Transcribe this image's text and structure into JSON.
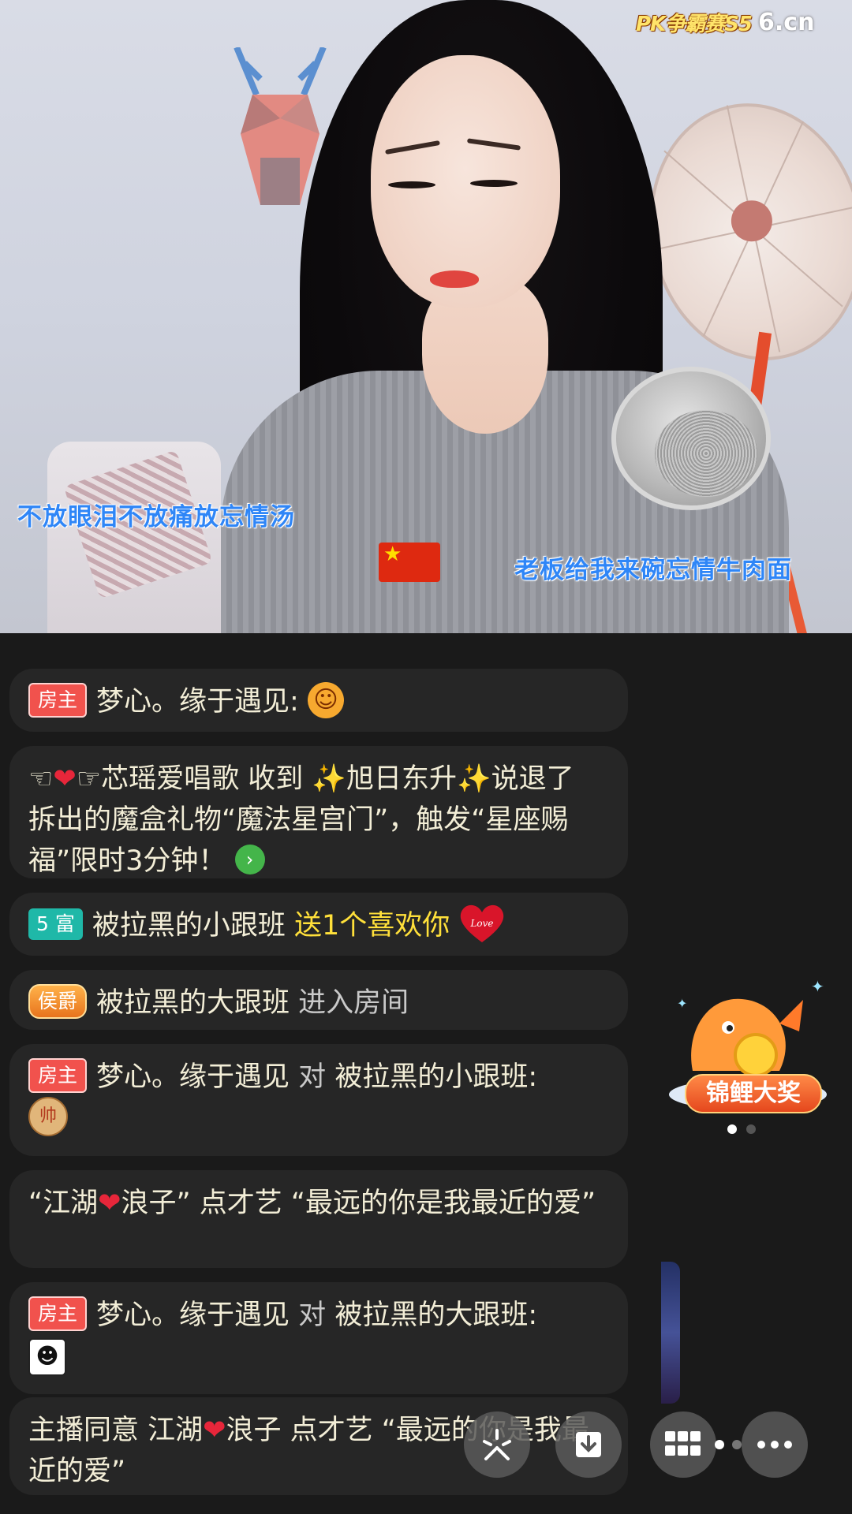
{
  "video": {
    "logo_badge": "PK争霸赛S5",
    "logo_site": "6.cn",
    "lyric_left": "不放眼泪不放痛放忘情汤",
    "lyric_right": "老板给我来碗忘情牛肉面"
  },
  "chat": [
    {
      "badge": "房主",
      "user": "梦心。缘于遇见:",
      "emoji": "face-emoji"
    },
    {
      "text_parts": [
        "芯瑶爱唱歌 收到 ",
        "旭日东升",
        "说退了 拆出的魔盒礼物“魔法星宫门”，触发“星座赐福”限时3分钟！"
      ]
    },
    {
      "badge": "5 富",
      "user": "被拉黑的小跟班",
      "gift": "送1个喜欢你",
      "emoji_text": "Love"
    },
    {
      "badge": "侯爵",
      "user": "被拉黑的大跟班",
      "action": "进入房间"
    },
    {
      "badge": "房主",
      "user": "梦心。缘于遇见",
      "connector": "对",
      "target": "被拉黑的小跟班:",
      "emoji_text": "帅"
    },
    {
      "text_a": "“江湖",
      "text_b": "浪子” 点才艺 “最远的你是我最近的爱”"
    },
    {
      "badge": "房主",
      "user": "梦心。缘于遇见",
      "connector": "对",
      "target": "被拉黑的大跟班:"
    },
    {
      "text_a": "主播同意 江湖",
      "text_b": "浪子 点才艺 “最远的你是我最近的爱”"
    }
  ],
  "prize": {
    "label": "锦鲤大奖"
  },
  "toolbar": {
    "icons": [
      "sparkle-icon",
      "download-icon",
      "grid-icon",
      "more-icon"
    ]
  },
  "colors": {
    "host_badge": "#f1524d",
    "rich_badge": "#1fb8a8",
    "gift_text": "#ffe03a",
    "lyric": "#2f86f7"
  }
}
